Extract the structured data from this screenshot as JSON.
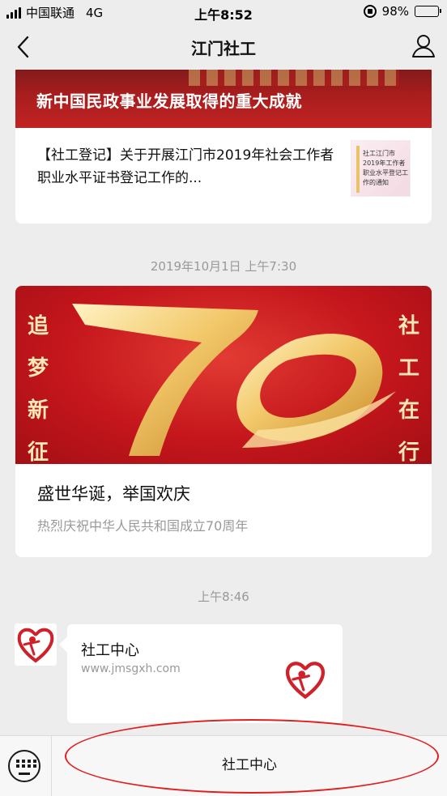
{
  "status_bar": {
    "carrier": "中国联通",
    "network": "4G",
    "time": "上午8:52",
    "battery": "98%",
    "battery_level": 0.98
  },
  "nav": {
    "title": "江门社工",
    "back_icon": "chevron-left-icon",
    "profile_icon": "person-icon"
  },
  "feed": {
    "article_card": {
      "banner_caption": "新中国民政事业发展取得的重大成就",
      "item_title": "【社工登记】关于开展江门市2019年社会工作者职业水平证书登记工作的...",
      "thumb_text": "社工江门市2019年工作者职业水平登记工作的通知"
    },
    "timestamp_1": "2019年10月1日 上午7:30",
    "celebration_card": {
      "left_banner_text": "追梦新征",
      "right_banner_text": "社工在行",
      "banner_number": "70",
      "title": "盛世华诞，举国欢庆",
      "subtitle": "热烈庆祝中华人民共和国成立70周年"
    },
    "timestamp_2": "上午8:46",
    "link_message": {
      "title": "社工中心",
      "url": "www.jmsgxh.com"
    }
  },
  "bottom_bar": {
    "keyboard_icon": "keyboard-icon",
    "menu_item_label": "社工中心"
  },
  "colors": {
    "accent_red": "#c4161c",
    "highlight_circle": "#e02020",
    "background": "#ededed"
  }
}
